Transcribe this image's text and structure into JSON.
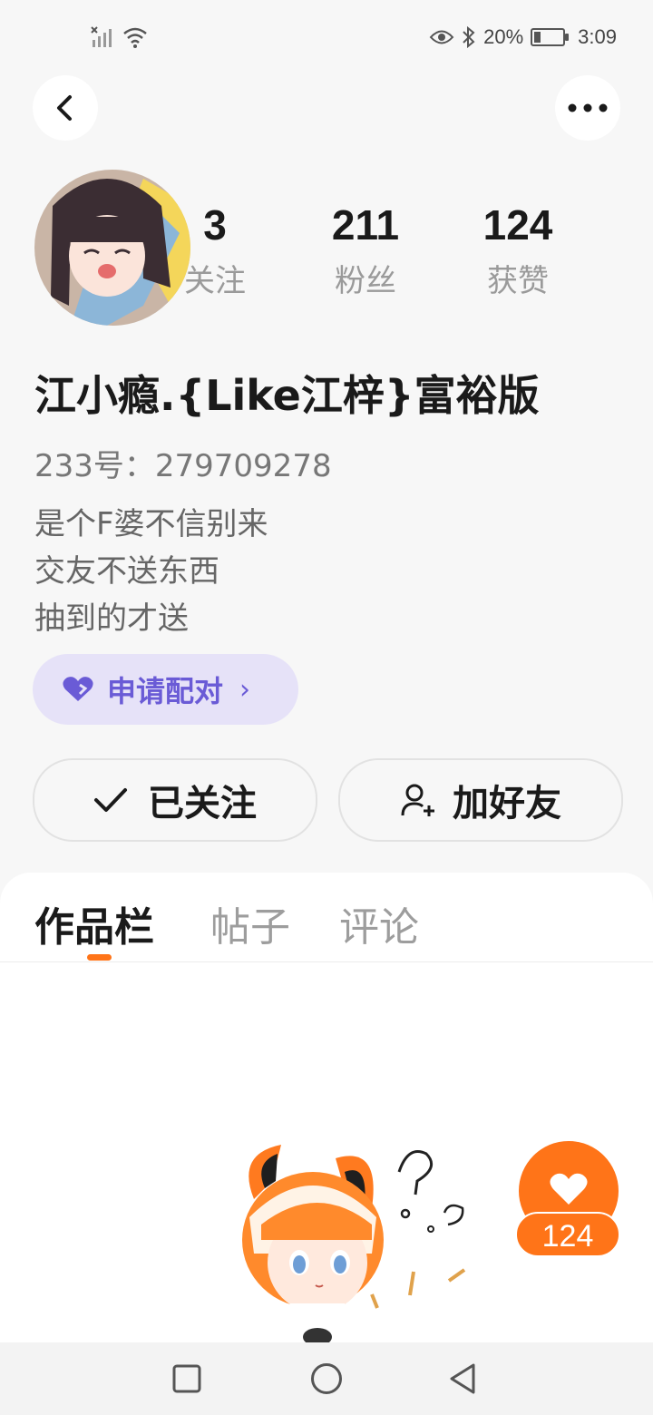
{
  "status_bar": {
    "battery_percent": "20%",
    "time": "3:09",
    "battery_level": 0.2
  },
  "header": {
    "back_icon": "chevron-left-icon",
    "more_icon": "more-dots-icon"
  },
  "profile": {
    "stats": [
      {
        "value": "3",
        "label": "关注"
      },
      {
        "value": "211",
        "label": "粉丝"
      },
      {
        "value": "124",
        "label": "获赞"
      }
    ],
    "username": "江小瘾.{Like江梓}富裕版",
    "id_text": "233号：279709278",
    "bio_lines": [
      "是个F婆不信别来",
      "交友不送东西",
      "抽到的才送"
    ]
  },
  "pair_button": {
    "label": "申请配对",
    "icon": "heart-icon"
  },
  "actions": {
    "following_label": "已关注",
    "add_friend_label": "加好友"
  },
  "tabs": [
    {
      "label": "作品栏",
      "active": true
    },
    {
      "label": "帖子",
      "active": false
    },
    {
      "label": "评论",
      "active": false
    }
  ],
  "like_fab": {
    "count": "124",
    "icon": "heart-icon"
  },
  "colors": {
    "accent": "#ff7418",
    "pair_bg": "#e6e2f8",
    "pair_text": "#6a5bd6"
  }
}
